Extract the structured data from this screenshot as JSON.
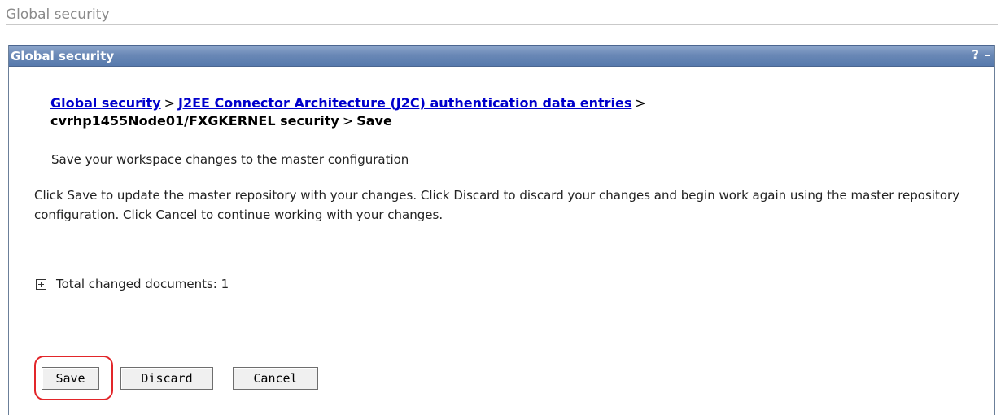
{
  "page_header": {
    "title": "Global security"
  },
  "portlet": {
    "title": "Global security",
    "help_glyph": "?",
    "minimize_glyph": "–"
  },
  "breadcrumb": {
    "link1": "Global security",
    "sep1": ">",
    "link2": "J2EE Connector Architecture (J2C) authentication data entries",
    "sep2": ">",
    "item3": "cvrhp1455Node01/FXGKERNEL security",
    "sep3": ">",
    "current": "Save"
  },
  "content": {
    "subtitle": "Save your workspace changes to the master configuration",
    "description": "Click Save to update the master repository with your changes. Click Discard to discard your changes and begin work again using the master repository configuration. Click Cancel to continue working with your changes.",
    "changed_docs_label": "Total changed documents: 1"
  },
  "buttons": {
    "save": "Save",
    "discard": "Discard",
    "cancel": "Cancel"
  },
  "icons": {
    "expand": "expand-plus-icon",
    "help": "help-icon",
    "minimize": "minimize-icon"
  },
  "colors": {
    "titlebar": "#6a88b6",
    "link": "#0000cc",
    "highlight": "#e2262a"
  }
}
